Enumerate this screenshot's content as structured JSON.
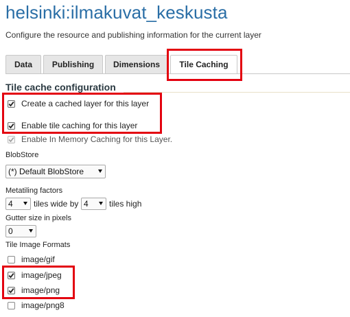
{
  "page": {
    "title": "helsinki:ilmakuvat_keskusta",
    "description": "Configure the resource and publishing information for the current layer"
  },
  "tabs": [
    {
      "label": "Data",
      "active": false
    },
    {
      "label": "Publishing",
      "active": false
    },
    {
      "label": "Dimensions",
      "active": false
    },
    {
      "label": "Tile Caching",
      "active": true
    }
  ],
  "tile_cache": {
    "section_title": "Tile cache configuration",
    "create_cached_layer": {
      "label": "Create a cached layer for this layer",
      "checked": true
    },
    "enable_tile_caching": {
      "label": "Enable tile caching for this layer",
      "checked": true
    },
    "in_memory_caching": {
      "label": "Enable In Memory Caching for this Layer.",
      "checked": true,
      "disabled": true
    },
    "blobstore": {
      "label": "BlobStore",
      "selected": "(*) Default BlobStore"
    },
    "metatiling": {
      "label": "Metatiling factors",
      "wide_value": "4",
      "wide_text": "tiles wide by",
      "high_value": "4",
      "high_text": "tiles high"
    },
    "gutter": {
      "label": "Gutter size in pixels",
      "value": "0"
    },
    "image_formats": {
      "label": "Tile Image Formats",
      "items": [
        {
          "label": "image/gif",
          "checked": false
        },
        {
          "label": "image/jpeg",
          "checked": true
        },
        {
          "label": "image/png",
          "checked": true
        },
        {
          "label": "image/png8",
          "checked": false
        }
      ]
    }
  },
  "colors": {
    "title": "#2a6ea6",
    "highlight": "#e3000f"
  }
}
